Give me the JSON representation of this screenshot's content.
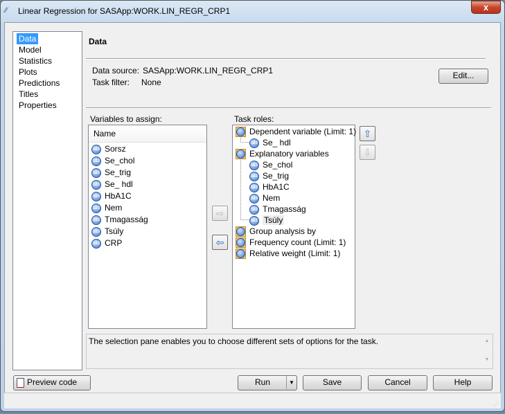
{
  "window": {
    "title": "Linear Regression for SASApp:WORK.LIN_REGR_CRP1",
    "close": "x"
  },
  "nav": {
    "items": [
      "Data",
      "Model",
      "Statistics",
      "Plots",
      "Predictions",
      "Titles",
      "Properties"
    ],
    "selected": "Data"
  },
  "page": {
    "heading": "Data",
    "data_source_label": "Data source:",
    "data_source": "SASApp:WORK.LIN_REGR_CRP1",
    "task_filter_label": "Task filter:",
    "task_filter": "None",
    "edit": "Edit..."
  },
  "variables": {
    "label": "Variables to assign:",
    "header": "Name",
    "items": [
      "Sorsz",
      "Se_chol",
      "Se_trig",
      "Se_ hdl",
      "HbA1C",
      "Nem",
      "Tmagasság",
      "Tsúly",
      "CRP"
    ]
  },
  "roles": {
    "label": "Task roles:",
    "dependent": "Dependent variable  (Limit: 1)",
    "dependent_items": [
      "Se_ hdl"
    ],
    "explanatory": "Explanatory variables",
    "explanatory_items": [
      "Se_chol",
      "Se_trig",
      "HbA1C",
      "Nem",
      "Tmagasság",
      "Tsúly"
    ],
    "group": "Group analysis by",
    "frequency": "Frequency count  (Limit: 1)",
    "weight": "Relative weight  (Limit: 1)",
    "selected": "Tsúly"
  },
  "description": "The selection pane enables you to choose different sets of options for the task.",
  "buttons": {
    "preview": "Preview code",
    "run": "Run",
    "save": "Save",
    "cancel": "Cancel",
    "help": "Help"
  },
  "icons": {
    "variable": "numeric-123-icon",
    "role": "role-icon",
    "move_right": "arrow-right-icon",
    "move_left": "arrow-left-icon",
    "up": "arrow-up-icon",
    "down": "arrow-down-icon"
  }
}
